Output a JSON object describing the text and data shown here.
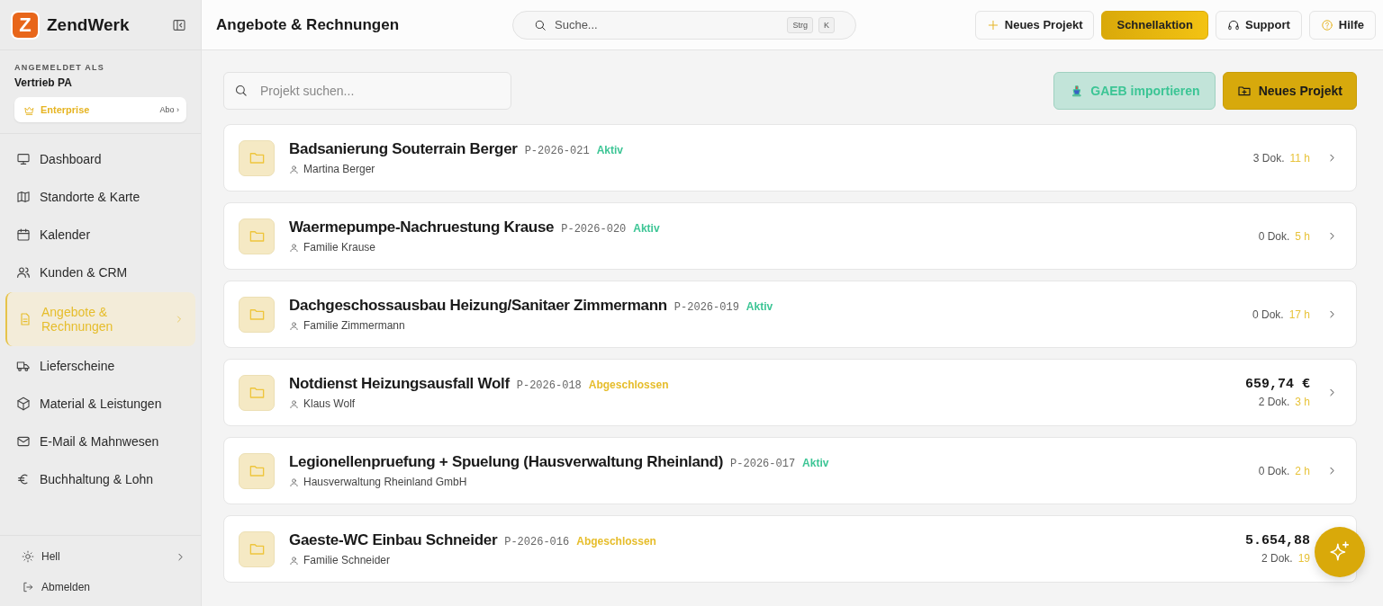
{
  "app": {
    "name": "ZendWerk",
    "logo_letter": "Z"
  },
  "user": {
    "label": "ANGEMELDET ALS",
    "name": "Vertrieb PA",
    "plan": "Enterprise",
    "plan_link": "Abo ›"
  },
  "nav": [
    {
      "label": "Dashboard",
      "selected": false
    },
    {
      "label": "Standorte & Karte",
      "selected": false
    },
    {
      "label": "Kalender",
      "selected": false
    },
    {
      "label": "Kunden & CRM",
      "selected": false
    },
    {
      "label": "Angebote & Rechnungen",
      "selected": true
    },
    {
      "label": "Lieferscheine",
      "selected": false
    },
    {
      "label": "Material & Leistungen",
      "selected": false
    },
    {
      "label": "E-Mail & Mahnwesen",
      "selected": false
    },
    {
      "label": "Buchhaltung & Lohn",
      "selected": false
    }
  ],
  "sidebar_footer": [
    {
      "label": "Hell",
      "kind": "theme"
    },
    {
      "label": "Abmelden",
      "kind": "logout"
    }
  ],
  "header": {
    "title": "Angebote & Rechnungen",
    "search": {
      "placeholder": "Suche...",
      "keys": [
        "Strg",
        "K"
      ]
    },
    "buttons": [
      {
        "label": "Neues Projekt",
        "kind": "plus"
      },
      {
        "label": "Schnellaktion",
        "kind": "primary"
      },
      {
        "label": "Support",
        "kind": "headset"
      },
      {
        "label": "Hilfe",
        "kind": "help"
      }
    ]
  },
  "toolbar": {
    "search": {
      "placeholder": "Projekt suchen..."
    },
    "buttons": [
      {
        "label": "GAEB importieren",
        "kind": "import"
      },
      {
        "label": "Neues Projekt",
        "kind": "new"
      }
    ]
  },
  "projects": [
    {
      "title": "Badsanierung Souterrain Berger",
      "code": "P-2026-021",
      "status": "Aktiv",
      "color": "#3cc595",
      "client": "Martina Berger",
      "docs": "3 Dok.",
      "hours": "11 h"
    },
    {
      "title": "Waermepumpe-Nachruestung Krause",
      "code": "P-2026-020",
      "status": "Aktiv",
      "color": "#3cc595",
      "client": "Familie Krause",
      "docs": "0 Dok.",
      "hours": "5 h"
    },
    {
      "title": "Dachgeschossausbau Heizung/Sanitaer Zimmermann",
      "code": "P-2026-019",
      "status": "Aktiv",
      "color": "#3cc595",
      "client": "Familie Zimmermann",
      "docs": "0 Dok.",
      "hours": "17 h"
    },
    {
      "title": "Notdienst Heizungsausfall Wolf",
      "code": "P-2026-018",
      "status": "Abgeschlossen",
      "color": "#e6bd2b",
      "client": "Klaus Wolf",
      "amount": "659,74 €",
      "docs": "2 Dok.",
      "hours": "3 h"
    },
    {
      "title": "Legionellenpruefung + Spuelung (Hausverwaltung Rheinland)",
      "code": "P-2026-017",
      "status": "Aktiv",
      "color": "#3cc595",
      "client": "Hausverwaltung Rheinland GmbH",
      "docs": "0 Dok.",
      "hours": "2 h"
    },
    {
      "title": "Gaeste-WC Einbau Schneider",
      "code": "P-2026-016",
      "status": "Abgeschlossen",
      "color": "#e6bd2b",
      "client": "Familie Schneider",
      "amount": "5.654,88",
      "docs": "2 Dok.",
      "hours": "19"
    }
  ]
}
